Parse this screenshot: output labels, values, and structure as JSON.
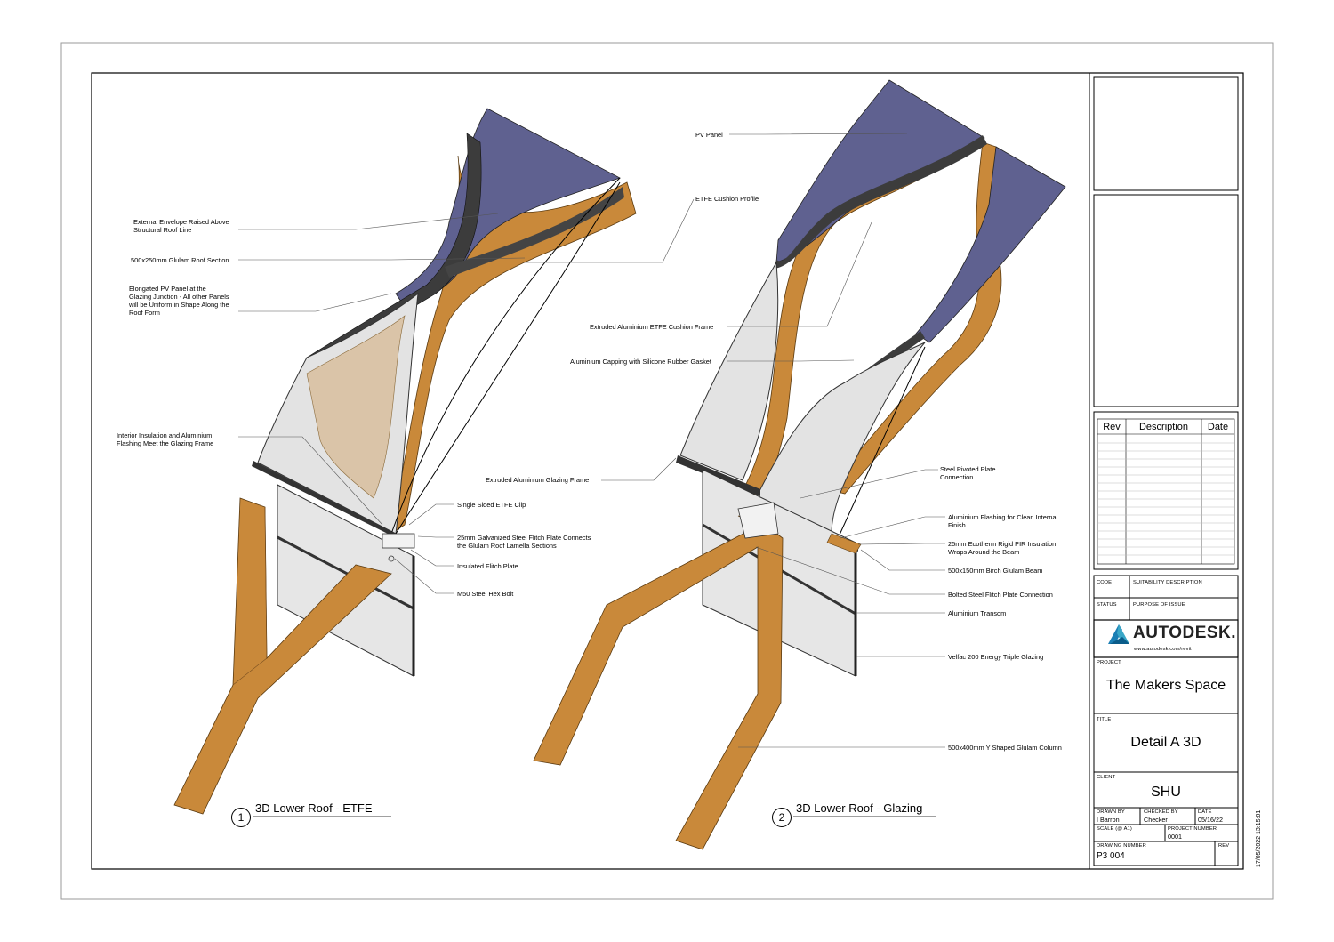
{
  "views": [
    {
      "number": "1",
      "title": "3D Lower Roof - ETFE"
    },
    {
      "number": "2",
      "title": "3D Lower Roof - Glazing"
    }
  ],
  "callouts_left": [
    "External Envelope Raised Above\nStructural Roof Line",
    "500x250mm Glulam Roof Section",
    "Elongated PV Panel at the\nGlazing Junction - All other Panels\nwill be Uniform in Shape Along the\nRoof Form",
    "Interior Insulation and Aluminium\nFlashing Meet the Glazing Frame",
    "Single Sided ETFE Clip",
    "25mm Galvanized Steel Flitch Plate Connects\nthe Glulam Roof Lamella Sections",
    "Insulated Flitch Plate",
    "M50 Steel Hex Bolt"
  ],
  "callouts_center": [
    "PV Panel",
    "ETFE Cushion Profile",
    "Extruded Aluminium ETFE Cushion Frame",
    "Aluminium Capping with Silicone Rubber Gasket",
    "Extruded Aluminium Glazing Frame"
  ],
  "callouts_right": [
    "Steel Pivoted Plate\nConnection",
    "Aluminium Flashing for Clean Internal\nFinish",
    "25mm Ecotherm Rigid PIR Insulation\nWraps Around the Beam",
    "500x150mm Birch Glulam Beam",
    "Bolted Steel Flitch Plate Connection",
    "Aluminium Transom",
    "Velfac 200 Energy Triple Glazing",
    "500x400mm Y Shaped Glulam Column"
  ],
  "title_block": {
    "rev_headers": [
      "Rev",
      "Description",
      "Date"
    ],
    "code_label": "CODE",
    "suitability_label": "SUITABILITY DESCRIPTION",
    "status_label": "STATUS",
    "purpose_label": "PURPOSE OF ISSUE",
    "logo_text": "AUTODESK.",
    "logo_url": "www.autodesk.com/revit",
    "project_label": "PROJECT",
    "project": "The Makers Space",
    "title_label": "TITLE",
    "title": "Detail A 3D",
    "client_label": "CLIENT",
    "client": "SHU",
    "drawn_by_label": "DRAWN BY",
    "drawn_by": "I Barron",
    "checked_by_label": "CHECKED BY",
    "checked_by": "Checker",
    "date_label": "DATE",
    "date": "05/16/22",
    "scale_label": "SCALE (@ A1)",
    "project_number_label": "PROJECT NUMBER",
    "project_number": "0001",
    "drawing_number_label": "DRAWING NUMBER",
    "drawing_number": "P3 004",
    "rev_label": "REV"
  },
  "print_stamp": "17/05/2022 13:15:01",
  "colors": {
    "pv": "#5f6190",
    "glulam": "#c9893a",
    "glass": "#e3e3e3",
    "frame": "#3c3c3c"
  }
}
